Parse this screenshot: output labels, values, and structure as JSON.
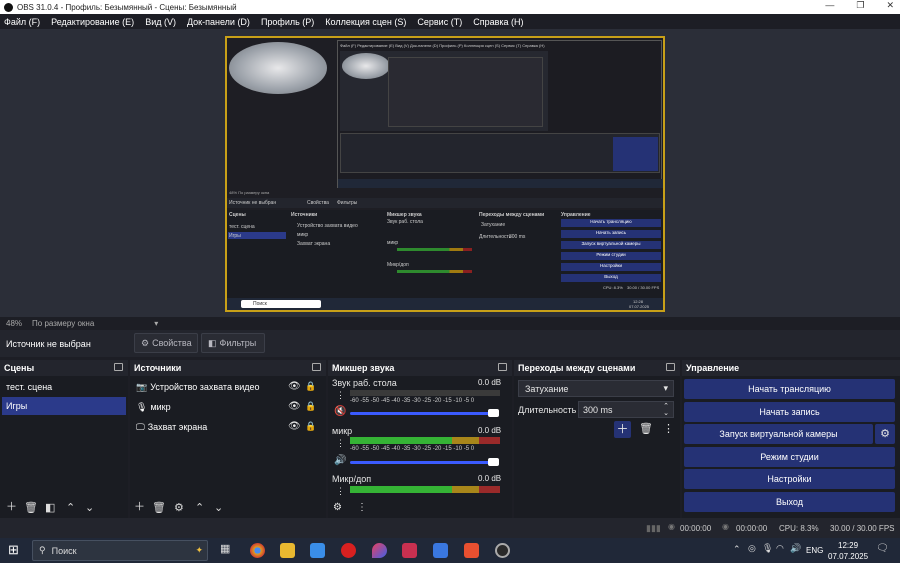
{
  "titlebar": {
    "title": "OBS 31.0.4 - Профиль: Безымянный - Сцены: Безымянный",
    "minimize": "—",
    "maximize": "❐",
    "close": "✕"
  },
  "menu": [
    "Файл (F)",
    "Редактирование (E)",
    "Вид (V)",
    "Док-панели (D)",
    "Профиль (P)",
    "Коллекция сцен (S)",
    "Сервис (T)",
    "Справка (H)"
  ],
  "preview": {
    "zoom": "48%",
    "zoom_mode": "По размеру окна"
  },
  "sourcebar": {
    "status": "Источник не выбран",
    "properties": "Свойства",
    "filters": "Фильтры"
  },
  "scenes": {
    "title": "Сцены",
    "items": [
      "тест. сцена",
      "Игры"
    ],
    "selected_index": 1
  },
  "sources": {
    "title": "Источники",
    "items": [
      "Устройство захвата видео",
      "микр",
      "Захват экрана"
    ]
  },
  "mixer": {
    "title": "Микшер звука",
    "channels": [
      {
        "name": "Звук раб. стола",
        "db": "0.0 dB",
        "muted": true,
        "volume": 1.0
      },
      {
        "name": "микр",
        "db": "0.0 dB",
        "muted": false,
        "volume": 1.0
      },
      {
        "name": "Микр/доп",
        "db": "0.0 dB",
        "muted": false,
        "volume": 1.0
      }
    ],
    "scale": [
      "-60",
      "-55",
      "-50",
      "-45",
      "-40",
      "-35",
      "-30",
      "-25",
      "-20",
      "-15",
      "-10",
      "-5",
      "0"
    ]
  },
  "transitions": {
    "title": "Переходы между сценами",
    "selected": "Затухание",
    "duration_label": "Длительность",
    "duration": "300 ms"
  },
  "controls": {
    "title": "Управление",
    "buttons": [
      "Начать трансляцию",
      "Начать запись",
      "Запуск виртуальной камеры",
      "Режим студии",
      "Настройки",
      "Выход"
    ]
  },
  "status": {
    "stream_time": "00:00:00",
    "rec_time": "00:00:00",
    "cpu": "CPU: 8.3%",
    "fps": "30.00 / 30.00 FPS"
  },
  "taskbar": {
    "search_placeholder": "Поиск",
    "lang": "ENG",
    "time": "12:29",
    "date": "07.07.2025"
  },
  "nested": {
    "menu": [
      "Файл (F)",
      "Редактирование (E)",
      "Вид (V)",
      "Док-панели (D)",
      "Профиль (P)",
      "Коллекция сцен (S)",
      "Сервис (T)",
      "Справка (H)"
    ],
    "zoom": "48%  По размеру окна",
    "source_status": "Источник не выбран",
    "properties": "Свойства",
    "filters": "Фильтры",
    "scenes_title": "Сцены",
    "scenes": [
      "тест. сцена",
      "Игры"
    ],
    "sources_title": "Источники",
    "sources": [
      "Устройство захвата видео",
      "микр",
      "Захват экрана"
    ],
    "mixer_title": "Микшер звука",
    "mixer_channels": [
      "Звук раб. стола",
      "микр",
      "Микр/доп"
    ],
    "transitions_title": "Переходы между сценами",
    "transition": "Затухание",
    "duration_label": "Длительность",
    "duration": "300 ms",
    "controls_title": "Управление",
    "controls": [
      "Начать трансляцию",
      "Начать запись",
      "Запуск виртуальной камеры",
      "Режим студии",
      "Настройки",
      "Выход"
    ],
    "search": "Поиск",
    "cpu": "CPU: 8.3%",
    "fps": "30.00 / 30.00 FPS",
    "time": "12:28",
    "date": "07.07.2025"
  }
}
